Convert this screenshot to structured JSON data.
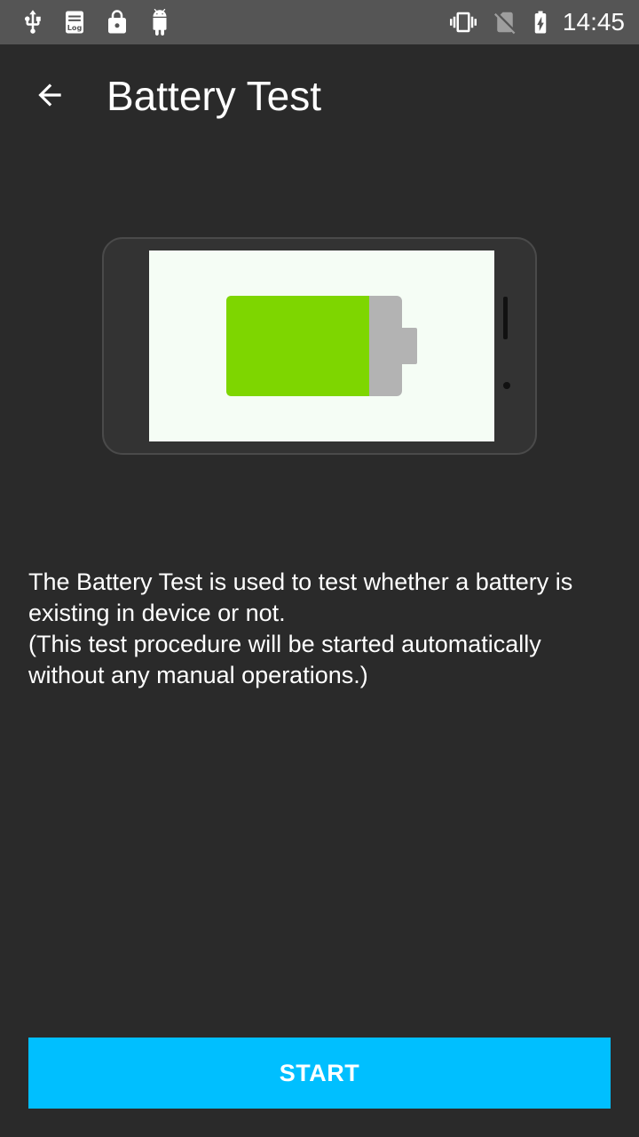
{
  "status_bar": {
    "time": "14:45",
    "left_icons": [
      "usb-icon",
      "log-icon",
      "lock-icon",
      "android-icon"
    ],
    "right_icons": [
      "vibrate-icon",
      "no-sim-icon",
      "battery-charging-icon"
    ]
  },
  "app_bar": {
    "back_icon": "arrow-back-icon",
    "title": "Battery Test"
  },
  "illustration": {
    "name": "phone-battery-illustration",
    "battery_fill_color": "#7ed600",
    "battery_empty_color": "#b3b3b3"
  },
  "description": {
    "line1": "The Battery Test is used to test whether a battery is existing in device or not.",
    "line2": "(This test procedure will be started automatically without any manual operations.)"
  },
  "start_button": {
    "label": "START",
    "color": "#00bfff"
  }
}
